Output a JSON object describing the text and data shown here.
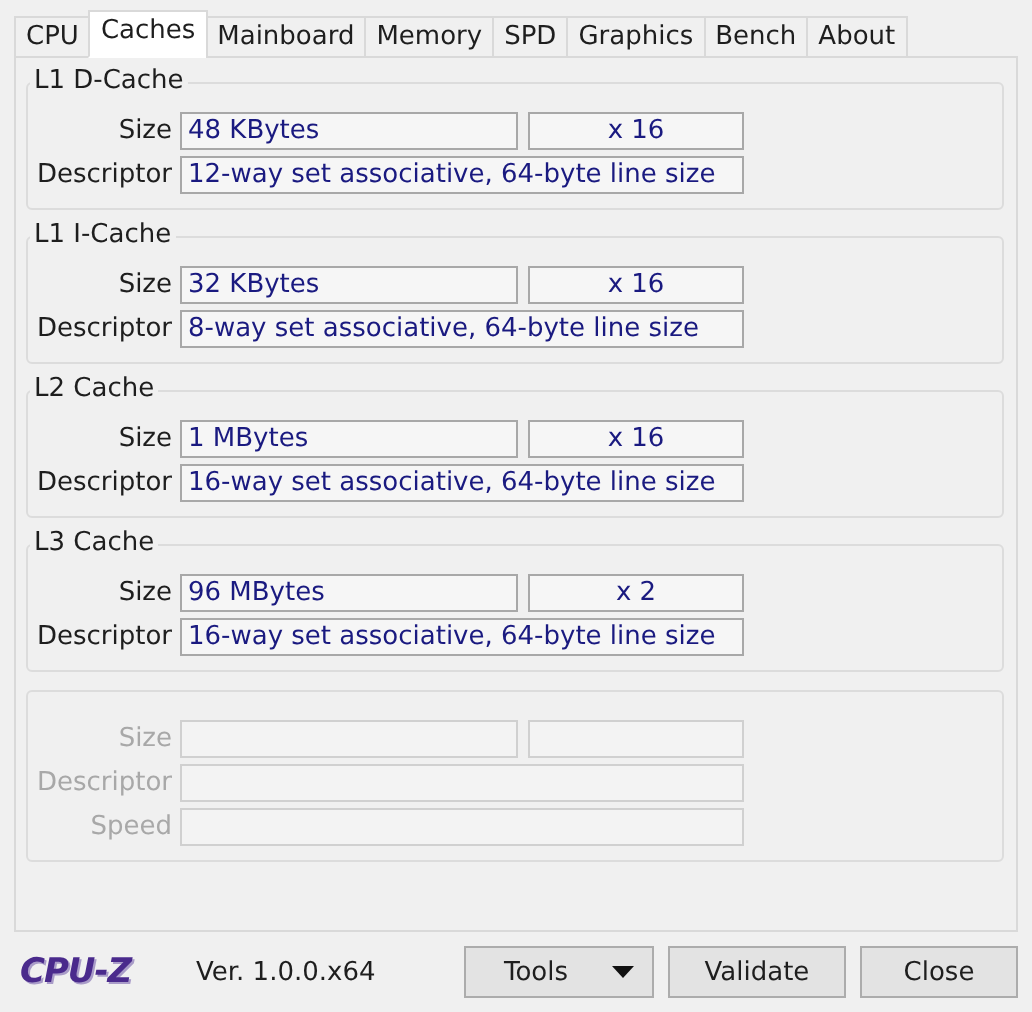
{
  "tabs": [
    {
      "label": "CPU",
      "selected": false
    },
    {
      "label": "Caches",
      "selected": true
    },
    {
      "label": "Mainboard",
      "selected": false
    },
    {
      "label": "Memory",
      "selected": false
    },
    {
      "label": "SPD",
      "selected": false
    },
    {
      "label": "Graphics",
      "selected": false
    },
    {
      "label": "Bench",
      "selected": false
    },
    {
      "label": "About",
      "selected": false
    }
  ],
  "groups": [
    {
      "title": "L1 D-Cache",
      "disabled": false,
      "rows": [
        {
          "kind": "pair",
          "label": "Size",
          "value": "48 KBytes",
          "count": "x 16"
        },
        {
          "kind": "wide",
          "label": "Descriptor",
          "value": "12-way set associative, 64-byte line size"
        }
      ]
    },
    {
      "title": "L1 I-Cache",
      "disabled": false,
      "rows": [
        {
          "kind": "pair",
          "label": "Size",
          "value": "32 KBytes",
          "count": "x 16"
        },
        {
          "kind": "wide",
          "label": "Descriptor",
          "value": "8-way set associative, 64-byte line size"
        }
      ]
    },
    {
      "title": "L2 Cache",
      "disabled": false,
      "rows": [
        {
          "kind": "pair",
          "label": "Size",
          "value": "1 MBytes",
          "count": "x 16"
        },
        {
          "kind": "wide",
          "label": "Descriptor",
          "value": "16-way set associative, 64-byte line size"
        }
      ]
    },
    {
      "title": "L3 Cache",
      "disabled": false,
      "rows": [
        {
          "kind": "pair",
          "label": "Size",
          "value": "96 MBytes",
          "count": "x 2"
        },
        {
          "kind": "wide",
          "label": "Descriptor",
          "value": "16-way set associative, 64-byte line size"
        }
      ]
    },
    {
      "disabled": true,
      "rows": [
        {
          "kind": "pair",
          "label": "Size"
        },
        {
          "kind": "wide",
          "label": "Descriptor"
        },
        {
          "kind": "wide",
          "label": "Speed"
        }
      ]
    }
  ],
  "footer": {
    "logo": "CPU-Z",
    "version": "Ver. 1.0.0.x64",
    "buttons": [
      {
        "label": "Tools",
        "kind": "menu"
      },
      {
        "label": "Validate",
        "kind": "plain"
      },
      {
        "label": "Close",
        "kind": "plain"
      }
    ]
  }
}
